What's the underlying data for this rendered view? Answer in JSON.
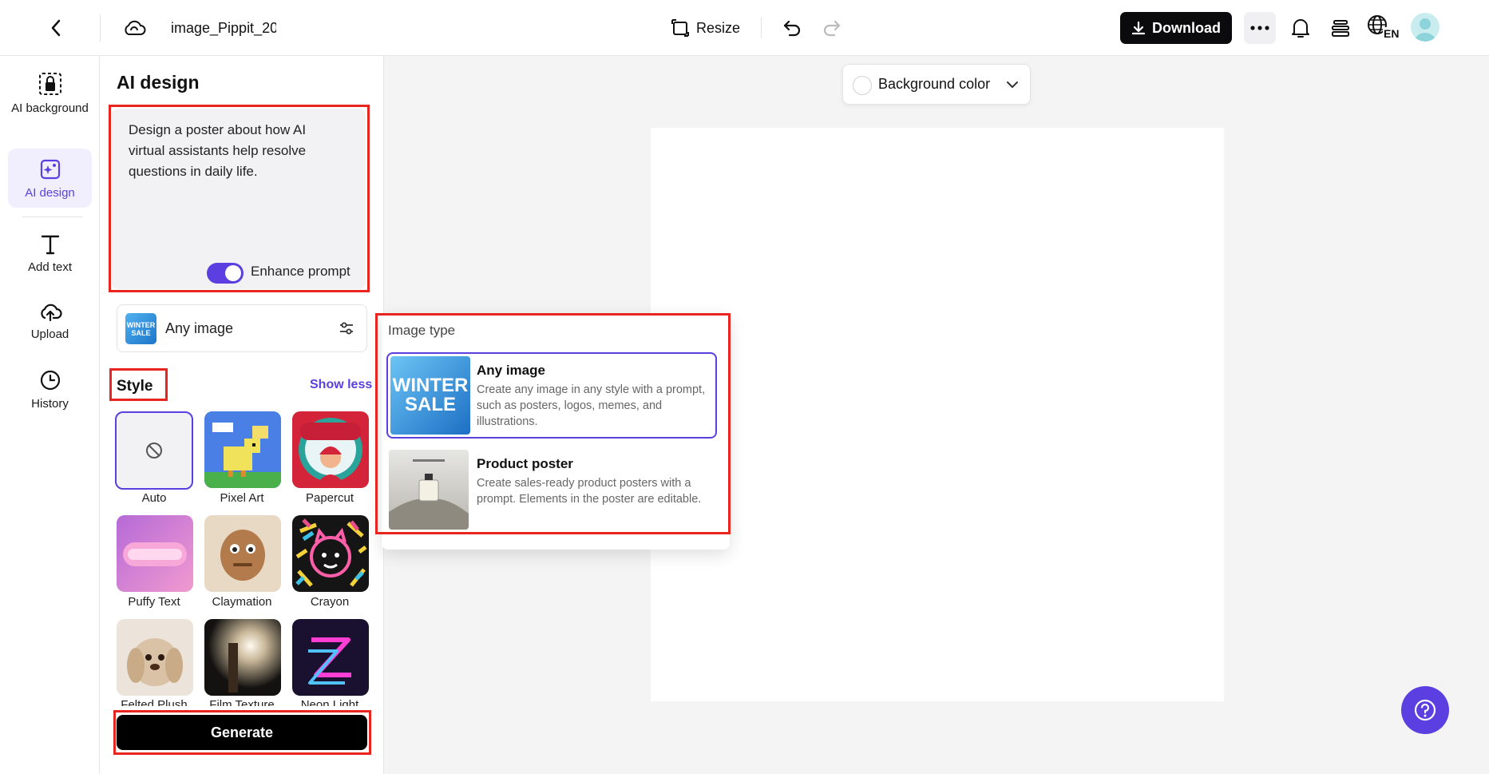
{
  "topbar": {
    "filename": "image_Pippit_20",
    "resize_label": "Resize",
    "download_label": "Download",
    "language_code": "EN"
  },
  "rail": {
    "items": [
      {
        "label": "AI background",
        "icon": "ai-background-icon"
      },
      {
        "label": "AI design",
        "icon": "ai-design-icon",
        "active": true
      },
      {
        "label": "Add text",
        "icon": "text-icon"
      },
      {
        "label": "Upload",
        "icon": "cloud-upload-icon"
      },
      {
        "label": "History",
        "icon": "clock-icon"
      }
    ]
  },
  "panel": {
    "title": "AI design",
    "prompt": "Design a poster about how AI virtual assistants help resolve questions in daily life.",
    "enhance_prompt_label": "Enhance prompt",
    "enhance_prompt_on": true,
    "image_type_selected": "Any image",
    "image_type_thumb_text": "WINTER SALE",
    "style_title": "Style",
    "show_less_label": "Show less",
    "styles": [
      {
        "label": "Auto",
        "selected": true
      },
      {
        "label": "Pixel Art"
      },
      {
        "label": "Papercut"
      },
      {
        "label": "Puffy Text"
      },
      {
        "label": "Claymation"
      },
      {
        "label": "Crayon"
      },
      {
        "label": "Felted Plush"
      },
      {
        "label": "Film Texture"
      },
      {
        "label": "Neon Light"
      }
    ],
    "generate_label": "Generate"
  },
  "canvas": {
    "background_color_label": "Background color"
  },
  "image_type_popup": {
    "title": "Image type",
    "options": [
      {
        "title": "Any image",
        "description": "Create any image in any style with a prompt, such as posters, logos, memes, and illustrations.",
        "thumb_text": "WINTER SALE",
        "selected": true
      },
      {
        "title": "Product poster",
        "description": "Create sales-ready product posters with a prompt. Elements in the poster are editable."
      }
    ]
  },
  "colors": {
    "accent": "#5b3fe0",
    "highlight": "#e8261f",
    "download_bg": "#0b0b0d"
  }
}
